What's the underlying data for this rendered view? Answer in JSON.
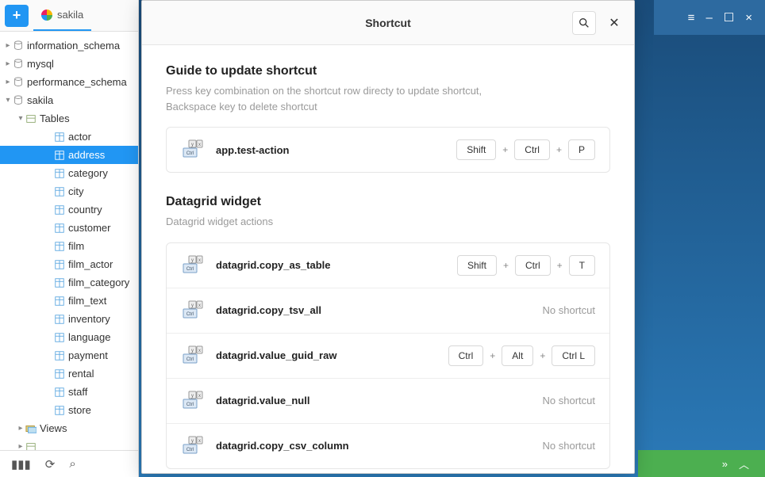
{
  "window": {
    "tab_label": "sakila",
    "controls": {
      "menu": "≡",
      "min": "–",
      "max": "☐",
      "close": "×"
    }
  },
  "sidebar": {
    "plus": "+",
    "databases": [
      {
        "name": "information_schema",
        "expanded": false
      },
      {
        "name": "mysql",
        "expanded": false
      },
      {
        "name": "performance_schema",
        "expanded": false
      },
      {
        "name": "sakila",
        "expanded": true
      }
    ],
    "tables_folder": "Tables",
    "tables": [
      "actor",
      "address",
      "category",
      "city",
      "country",
      "customer",
      "film",
      "film_actor",
      "film_category",
      "film_text",
      "inventory",
      "language",
      "payment",
      "rental",
      "staff",
      "store"
    ],
    "selected_table": "address",
    "views_folder": "Views"
  },
  "bottombar": {
    "signal": "▮▮▮",
    "refresh": "⟳",
    "search": "⌕"
  },
  "status": {
    "fwd": "»",
    "up": "︿"
  },
  "modal": {
    "title": "Shortcut",
    "guide": {
      "heading": "Guide to update shortcut",
      "line1": "Press key combination on the shortcut row directy to update shortcut,",
      "line2": "Backspace key to delete shortcut",
      "example": {
        "name": "app.test-action",
        "keys": [
          "Shift",
          "Ctrl",
          "P"
        ]
      }
    },
    "datagrid": {
      "heading": "Datagrid widget",
      "sub": "Datagrid widget actions",
      "rows": [
        {
          "name": "datagrid.copy_as_table",
          "keys": [
            "Shift",
            "Ctrl",
            "T"
          ]
        },
        {
          "name": "datagrid.copy_tsv_all",
          "no_shortcut": "No shortcut"
        },
        {
          "name": "datagrid.value_guid_raw",
          "keys": [
            "Ctrl",
            "Alt",
            "Ctrl L"
          ]
        },
        {
          "name": "datagrid.value_null",
          "no_shortcut": "No shortcut"
        },
        {
          "name": "datagrid.copy_csv_column",
          "no_shortcut": "No shortcut"
        }
      ]
    }
  }
}
